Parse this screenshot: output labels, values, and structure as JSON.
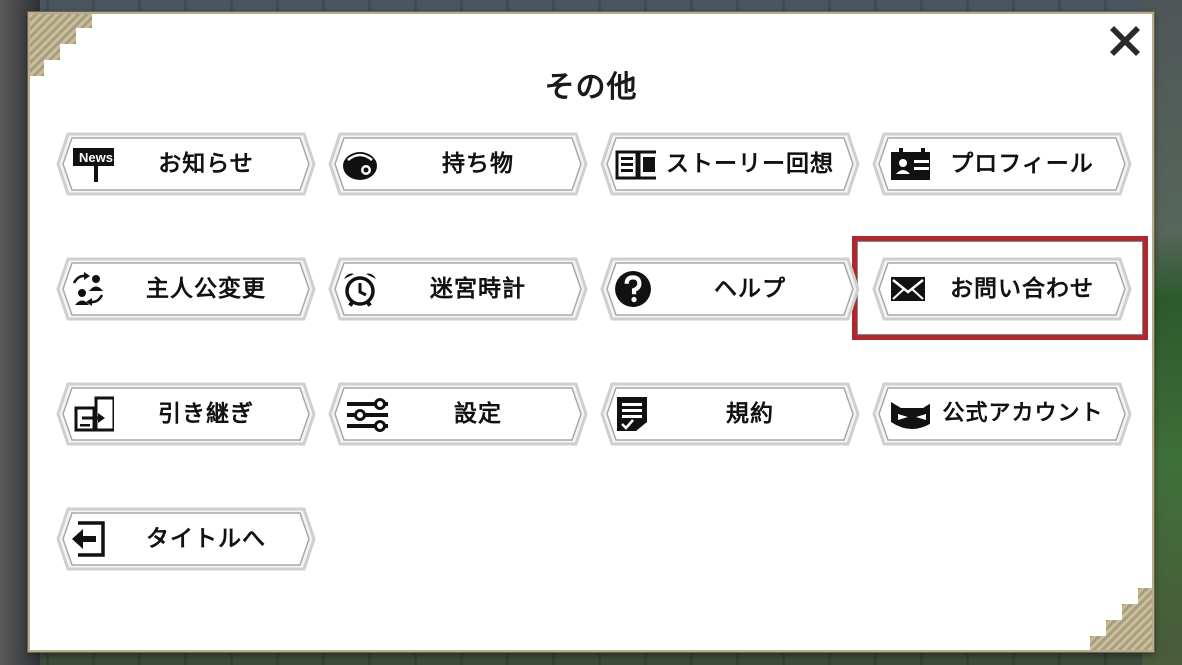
{
  "dialog": {
    "title": "その他",
    "close_icon": "close-icon"
  },
  "menu": [
    {
      "label": "お知らせ",
      "icon": "news-icon"
    },
    {
      "label": "持ち物",
      "icon": "bag-icon"
    },
    {
      "label": "ストーリー回想",
      "icon": "book-icon"
    },
    {
      "label": "プロフィール",
      "icon": "id-card-icon"
    },
    {
      "label": "主人公変更",
      "icon": "swap-character-icon"
    },
    {
      "label": "迷宮時計",
      "icon": "alarm-clock-icon"
    },
    {
      "label": "ヘルプ",
      "icon": "question-icon"
    },
    {
      "label": "お問い合わせ",
      "icon": "mail-icon",
      "selected": true
    },
    {
      "label": "引き継ぎ",
      "icon": "transfer-icon"
    },
    {
      "label": "設定",
      "icon": "settings-sliders-icon"
    },
    {
      "label": "規約",
      "icon": "document-icon"
    },
    {
      "label": "公式アカウント",
      "icon": "official-account-icon"
    },
    {
      "label": "タイトルへ",
      "icon": "exit-icon"
    }
  ],
  "news_icon_text": "News",
  "colors": {
    "highlight": "#b0282d",
    "panel_border": "#b7ad8c",
    "text": "#111111"
  }
}
